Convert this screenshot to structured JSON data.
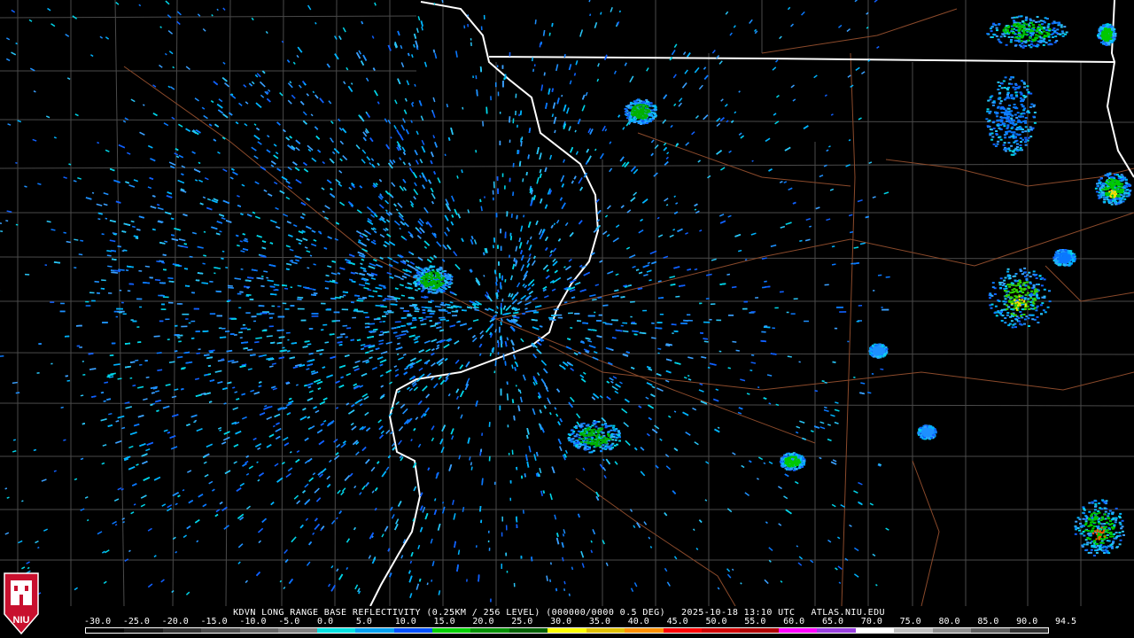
{
  "caption": {
    "product": "KDVN LONG RANGE BASE REFLECTIVITY (0.25KM / 256 LEVEL) (000000/0000 0.5 DEG)",
    "timestamp": "2025-10-18 13:10 UTC",
    "source": "ATLAS.NIU.EDU"
  },
  "logo": {
    "text": "NIU",
    "name": "niu-logo"
  },
  "scale": {
    "labels": [
      "-30.0",
      "-25.0",
      "-20.0",
      "-15.0",
      "-10.0",
      "-5.0",
      "0.0",
      "5.0",
      "10.0",
      "15.0",
      "20.0",
      "25.0",
      "30.0",
      "35.0",
      "40.0",
      "45.0",
      "50.0",
      "55.0",
      "60.0",
      "65.0",
      "70.0",
      "75.0",
      "80.0",
      "85.0",
      "90.0",
      "94.5"
    ],
    "colors": [
      "#000000",
      "#1a1a1a",
      "#333333",
      "#4d4d4d",
      "#666666",
      "#808080",
      "#00e0e0",
      "#00a0f0",
      "#0050ff",
      "#00d000",
      "#009000",
      "#006000",
      "#ffff00",
      "#e0c000",
      "#ff9000",
      "#ff0000",
      "#d00000",
      "#b00000",
      "#ff00ff",
      "#9a40e0",
      "#ffffff",
      "#c0c0c0",
      "#909090",
      "#606060",
      "#303030"
    ]
  },
  "colors": {
    "background": "#000000",
    "county_lines": "#4a4a4a",
    "state_lines": "#ffffff",
    "roads": "#8b4a2b"
  }
}
